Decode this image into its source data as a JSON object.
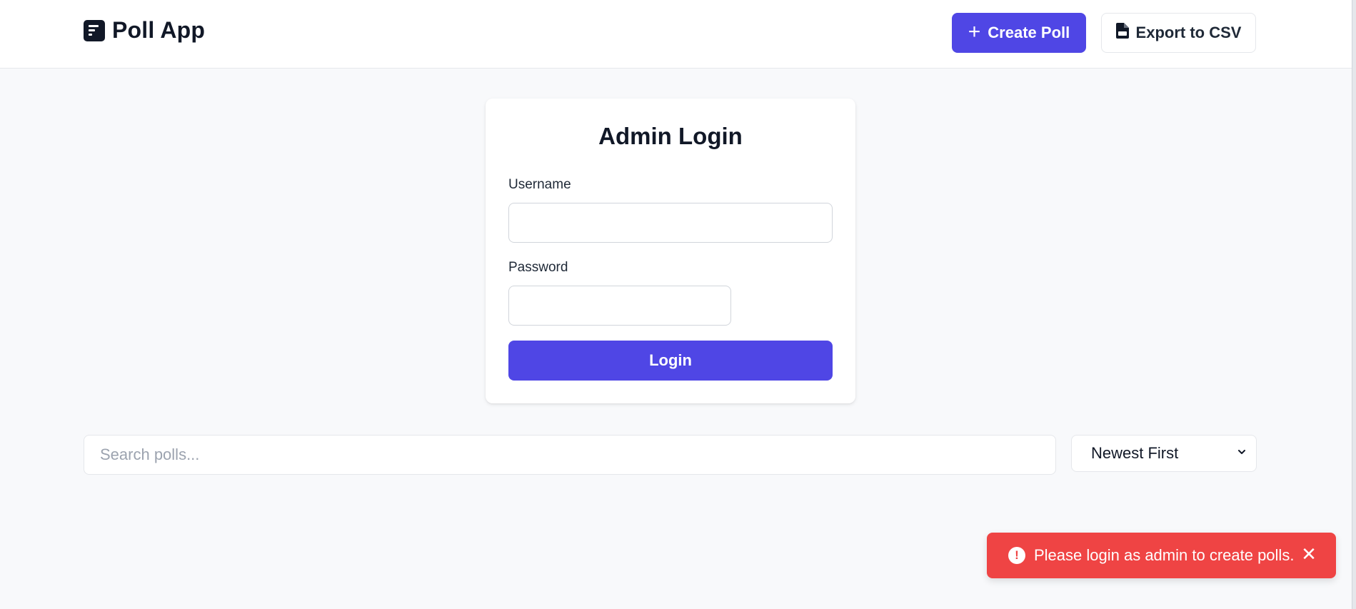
{
  "header": {
    "app_title": "Poll App",
    "create_label": "Create Poll",
    "export_label": "Export to CSV",
    "create_icon": "plus-icon",
    "export_icon": "csv-file-icon",
    "brand_icon": "poll-logo-icon"
  },
  "login": {
    "title": "Admin Login",
    "username_label": "Username",
    "username_value": "",
    "password_label": "Password",
    "password_value": "",
    "submit_label": "Login"
  },
  "search": {
    "placeholder": "Search polls...",
    "value": ""
  },
  "sort": {
    "selected": "Newest First"
  },
  "toast": {
    "message": "Please login as admin to create polls.",
    "icon": "alert-circle-icon",
    "close_label": "✕",
    "color": "#ef4444"
  },
  "colors": {
    "accent": "#4f46e5",
    "background": "#f8f9fb",
    "error": "#ef4444"
  }
}
